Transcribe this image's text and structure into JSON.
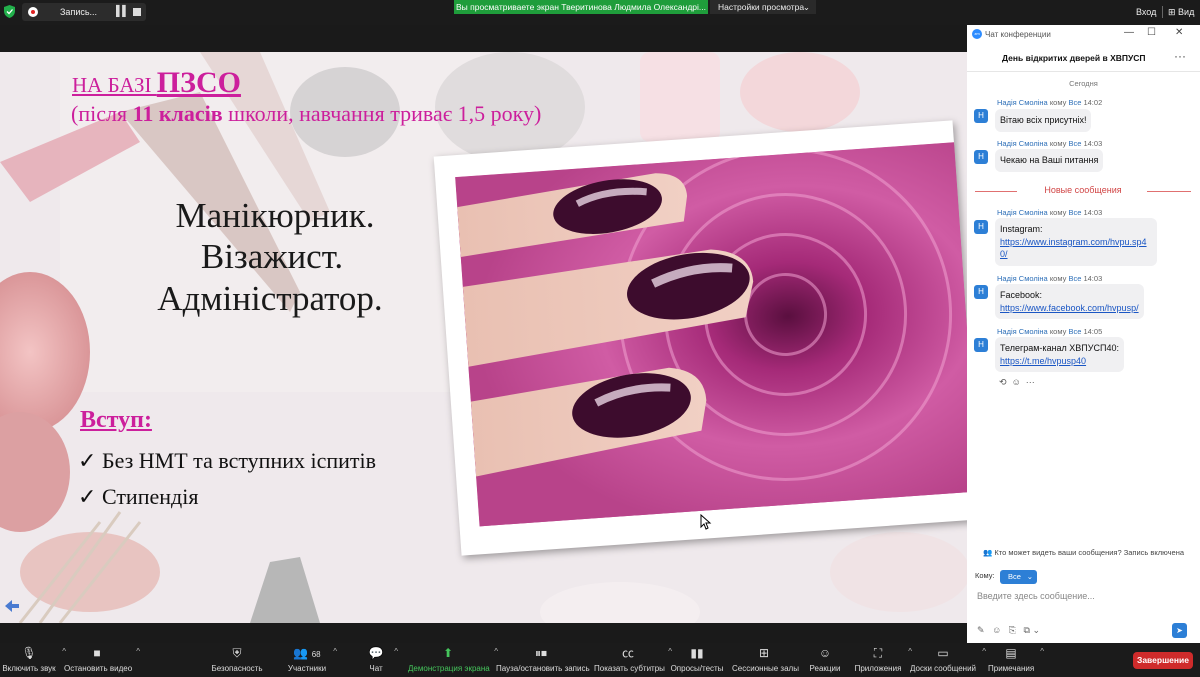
{
  "topbar": {
    "record_label": "Запись...",
    "viewing_text": "Вы просматриваете экран Тверитинова Людмила Олександрі...",
    "view_options": "Настройки просмотра",
    "signin": "Вход",
    "view": "Вид"
  },
  "slide": {
    "line1_prefix": "НА БАЗІ ",
    "line1_big": "ПЗСО",
    "line2_a": "(після ",
    "line2_b": "11 класів",
    "line2_c": " школи, навчання триває 1,5 року)",
    "professions": [
      "Манікюрник.",
      "Візажист.",
      "Адміністратор."
    ],
    "entry_title": "Вступ:",
    "bullets": [
      "Без НМТ та вступних іспитів",
      "Стипендія"
    ]
  },
  "chat": {
    "window_title": "Чат конференции",
    "meeting_title": "День відкритих дверей в ХВПУСП",
    "today": "Сегодня",
    "new_messages": "Новые сообщения",
    "messages": [
      {
        "sender": "Надія Смоліна",
        "to_word": "кому",
        "to": "Все",
        "time": "14:02",
        "lines": [
          "Вітаю всіх присутніх!"
        ],
        "link": ""
      },
      {
        "sender": "Надія Смоліна",
        "to_word": "кому",
        "to": "Все",
        "time": "14:03",
        "lines": [
          "Чекаю на Ваші питання"
        ],
        "link": ""
      },
      {
        "sender": "Надія Смоліна",
        "to_word": "кому",
        "to": "Все",
        "time": "14:03",
        "lines": [
          "Instagram:"
        ],
        "link": "https://www.instagram.com/hvpu.sp40/"
      },
      {
        "sender": "Надія Смоліна",
        "to_word": "кому",
        "to": "Все",
        "time": "14:03",
        "lines": [
          "Facebook:"
        ],
        "link": "https://www.facebook.com/hvpusp/"
      },
      {
        "sender": "Надія Смоліна",
        "to_word": "кому",
        "to": "Все",
        "time": "14:05",
        "lines": [
          "Телеграм-канал ХВПУСП40:"
        ],
        "link": "https://t.me/hvpusp40"
      }
    ],
    "avatar_letter": "Н",
    "notice": "Кто может видеть ваши сообщения? Запись включена",
    "to_label": "Кому:",
    "to_value": "Все",
    "input_placeholder": "Введите здесь сообщение..."
  },
  "toolbar": {
    "mute": "Включить звук",
    "video": "Остановить видео",
    "security": "Безопасность",
    "participants": "Участники",
    "participants_count": "68",
    "chat": "Чат",
    "share": "Демонстрация экрана",
    "pause_rec": "Пауза/остановить запись",
    "captions": "Показать субтитры",
    "polls": "Опросы/тесты",
    "breakout": "Сессионные залы",
    "reactions": "Реакции",
    "apps": "Приложения",
    "whiteboards": "Доски сообщений",
    "notes": "Примечания",
    "end": "Завершение"
  },
  "colors": {
    "accent_green": "#1f9d3b",
    "slide_magenta": "#cc1f9c",
    "zoom_blue": "#2d7fd6",
    "end_red": "#cf2b2b"
  }
}
